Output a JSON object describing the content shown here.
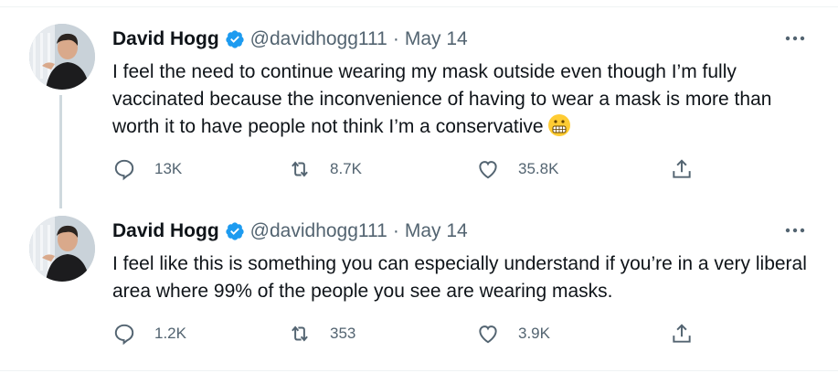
{
  "tweets": [
    {
      "author": {
        "name": "David Hogg",
        "handle": "@davidhogg111",
        "verified": true
      },
      "separator": "·",
      "date": "May 14",
      "text": "I feel the need to continue wearing my mask outside even though I’m fully vaccinated because the inconvenience of having to wear a mask is more than worth it to have people not think I’m a conservative",
      "emoji": "grimacing-face",
      "stats": {
        "replies": "13K",
        "retweets": "8.7K",
        "likes": "35.8K"
      }
    },
    {
      "author": {
        "name": "David Hogg",
        "handle": "@davidhogg111",
        "verified": true
      },
      "separator": "·",
      "date": "May 14",
      "text": "I feel like this is something you can especially understand if you’re in a very liberal area where 99% of the people you see are wearing masks.",
      "stats": {
        "replies": "1.2K",
        "retweets": "353",
        "likes": "3.9K"
      }
    }
  ],
  "icons": [
    "verified-badge-icon",
    "more-options-icon",
    "reply-icon",
    "retweet-icon",
    "like-icon",
    "share-icon"
  ],
  "colors": {
    "text": "#0f1419",
    "secondary": "#536471",
    "verified": "#1d9bf0",
    "divider": "#eff3f4",
    "thread_line": "#cfd9de"
  }
}
